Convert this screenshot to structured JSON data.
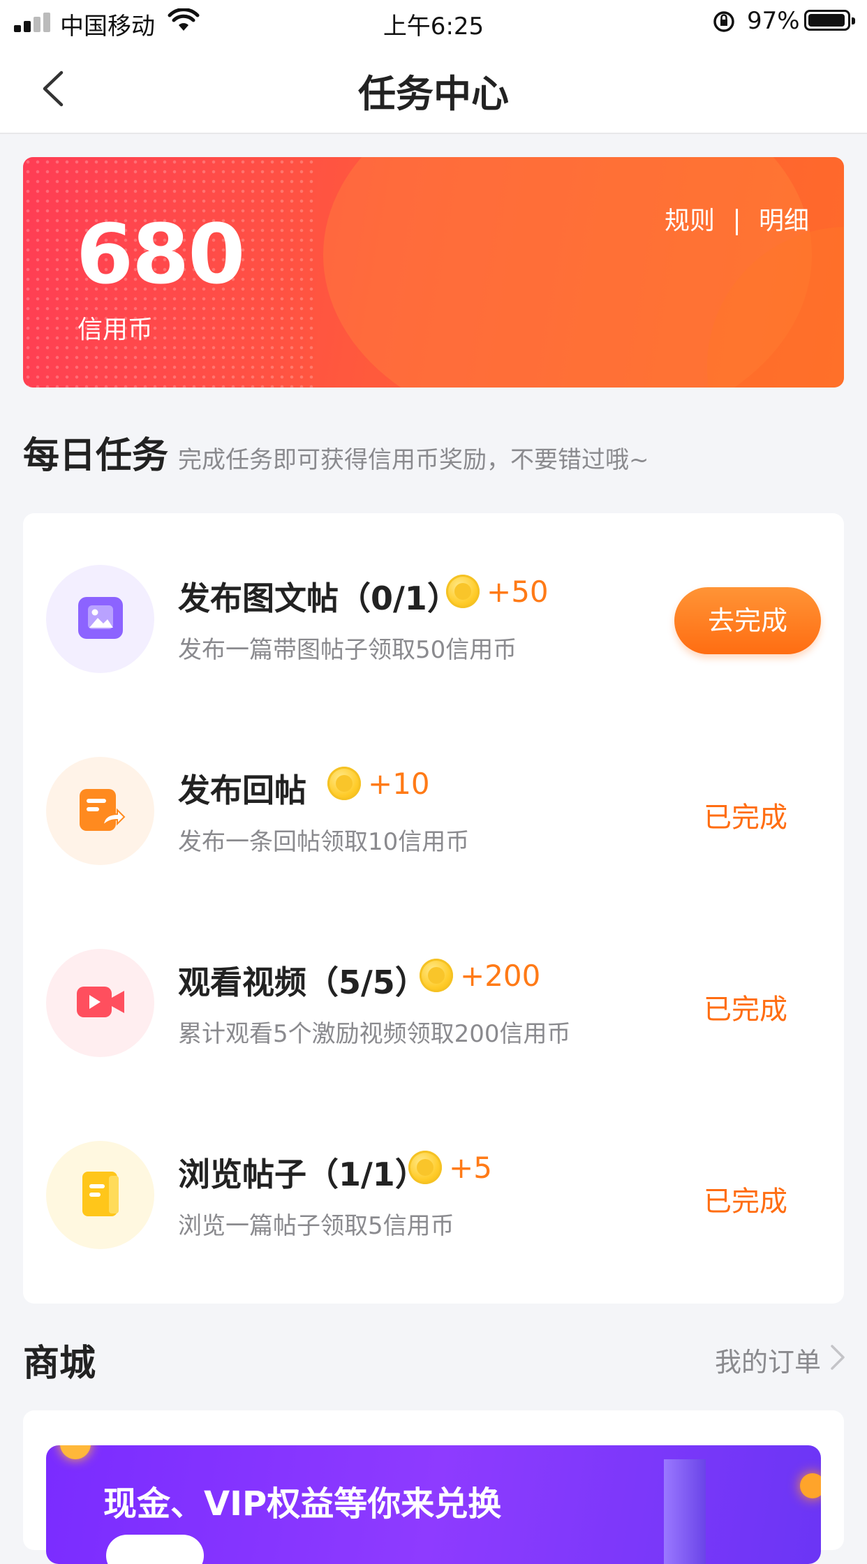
{
  "status_bar": {
    "carrier": "中国移动",
    "time": "上午6:25",
    "battery_pct": "97%"
  },
  "nav": {
    "title": "任务中心"
  },
  "wallet": {
    "balance": "680",
    "unit_label": "信用币",
    "rules_link": "规则",
    "details_link": "明细"
  },
  "daily": {
    "title": "每日任务",
    "subtitle": "完成任务即可获得信用币奖励，不要错过哦~",
    "tasks": [
      {
        "title": "发布图文帖（0/1）",
        "reward": "+50",
        "desc": "发布一篇带图帖子领取50信用币",
        "action": "去完成",
        "icon": "image-post-icon",
        "color": "#8c63ff"
      },
      {
        "title": "发布回帖",
        "reward": "+10",
        "desc": "发布一条回帖领取10信用币",
        "action": "已完成",
        "icon": "reply-post-icon",
        "color": "#ff8a1f"
      },
      {
        "title": "观看视频（5/5）",
        "reward": "+200",
        "desc": "累计观看5个激励视频领取200信用币",
        "action": "已完成",
        "icon": "video-icon",
        "color": "#ff4f5e"
      },
      {
        "title": "浏览帖子（1/1）",
        "reward": "+5",
        "desc": "浏览一篇帖子领取5信用币",
        "action": "已完成",
        "icon": "browse-post-icon",
        "color": "#ffc61a"
      }
    ]
  },
  "mall": {
    "title": "商城",
    "orders_link": "我的订单",
    "banner_text": "现金、VIP权益等你来兑换"
  }
}
